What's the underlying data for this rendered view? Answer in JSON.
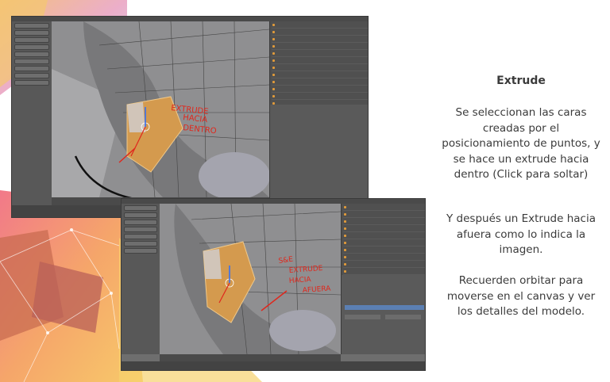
{
  "slide": {
    "title": "Extrude",
    "paragraph1": "Se seleccionan las caras creadas por el posicionamiento de puntos, y se hace un extrude hacia dentro (Click para soltar)",
    "paragraph2": "Y después un Extrude hacia afuera como lo indica la imagen.",
    "paragraph3": "Recuerden orbitar para moverse en el canvas y ver los detalles del modelo."
  },
  "screenshot1": {
    "annotation_lines": [
      "EXTRUDE",
      "HACIA",
      "DENTRO"
    ]
  },
  "screenshot2": {
    "annotation_lines": [
      "S&E",
      "EXTRUDE",
      "HACIA",
      "AFUERA"
    ]
  },
  "colors": {
    "selected_faces": "#d49a4e",
    "annotation_red": "#e0271c",
    "viewport_gray": "#8d8d8f",
    "panel_dark": "#505050"
  }
}
